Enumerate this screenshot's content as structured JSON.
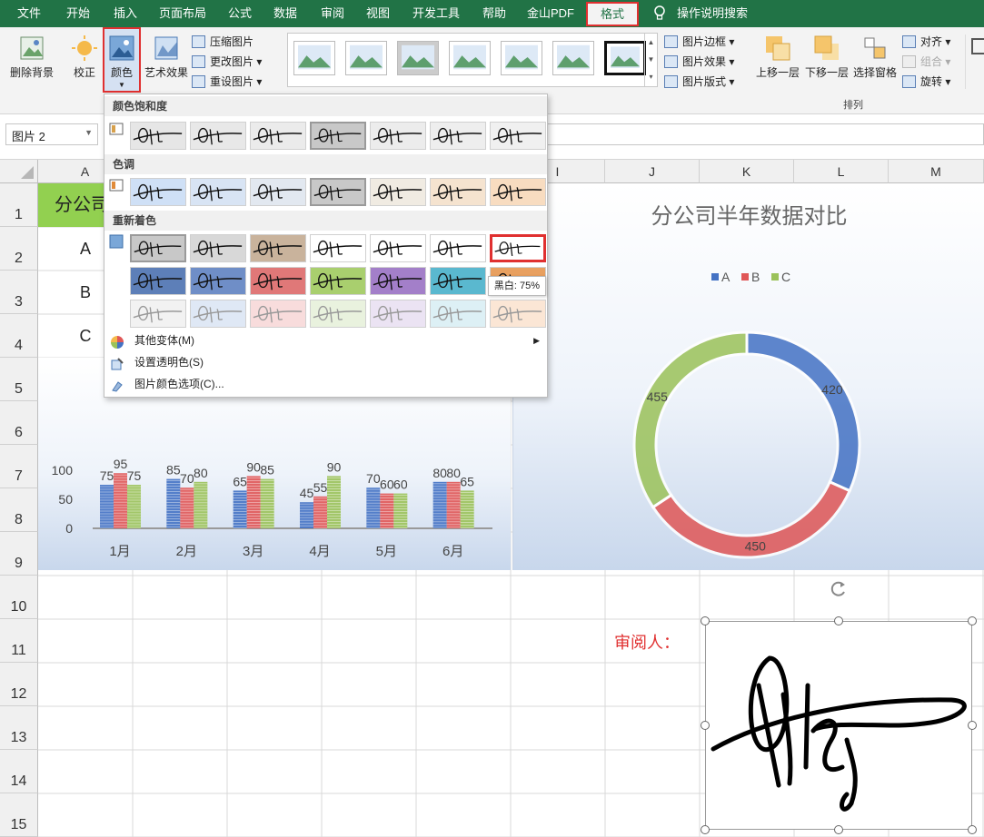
{
  "tabs": [
    "文件",
    "开始",
    "插入",
    "页面布局",
    "公式",
    "数据",
    "审阅",
    "视图",
    "开发工具",
    "帮助",
    "金山PDF",
    "格式",
    "操作说明搜索"
  ],
  "ribbon": {
    "remove_bg": "删除背景",
    "correct": "校正",
    "color": "颜色",
    "art": "艺术效果",
    "compress": "压缩图片",
    "change": "更改图片",
    "reset": "重设图片",
    "border": "图片边框",
    "effect": "图片效果",
    "layout": "图片版式",
    "bring_forward": "上移一层",
    "send_backward": "下移一层",
    "selection": "选择窗格",
    "align": "对齐",
    "group": "组合",
    "rotate": "旋转",
    "arrange_label": "排列"
  },
  "name_box": "图片 2",
  "columns": [
    "A",
    "I",
    "J",
    "K",
    "L",
    "M"
  ],
  "rows": [
    "1",
    "2",
    "3",
    "4",
    "5",
    "6",
    "7",
    "8",
    "9",
    "10",
    "11",
    "12",
    "13",
    "14",
    "15"
  ],
  "cells": {
    "a1": "分公司",
    "a2": "A",
    "a3": "B",
    "a4": "C"
  },
  "reviewer": "审阅人：",
  "menu": {
    "saturation": "颜色饱和度",
    "tone": "色调",
    "recolor": "重新着色",
    "tooltip": "黑白: 75%",
    "more": "其他变体(M)",
    "transparent": "设置透明色(S)",
    "options": "图片颜色选项(C)..."
  },
  "chart_data": [
    {
      "type": "bar",
      "categories": [
        "1月",
        "2月",
        "3月",
        "4月",
        "5月",
        "6月"
      ],
      "series": [
        {
          "name": "A",
          "values": [
            75,
            85,
            65,
            45,
            70,
            80
          ]
        },
        {
          "name": "B",
          "values": [
            95,
            70,
            90,
            55,
            60,
            80
          ]
        },
        {
          "name": "C",
          "values": [
            75,
            80,
            85,
            90,
            60,
            65
          ]
        }
      ],
      "yticks": [
        0,
        50,
        100
      ],
      "legend": "top"
    },
    {
      "type": "pie",
      "title": "分公司半年数据对比",
      "categories": [
        "A",
        "B",
        "C"
      ],
      "values": [
        420,
        450,
        455
      ],
      "donut": true,
      "legend": "top"
    }
  ],
  "colors": {
    "A": "#4472c4",
    "B": "#e05757",
    "C": "#9bc25a",
    "excel_green": "#217346",
    "highlight": "#e03030"
  }
}
